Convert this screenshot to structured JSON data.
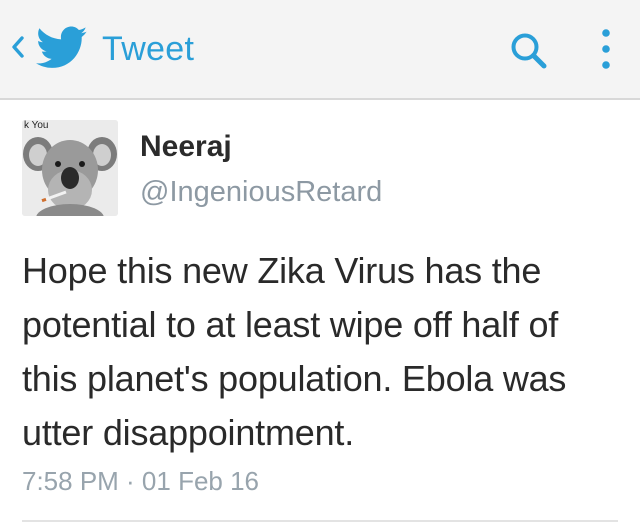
{
  "header": {
    "title": "Tweet",
    "back_icon": "chevron-left-icon",
    "logo_icon": "twitter-bird-icon",
    "search_icon": "search-icon",
    "more_icon": "more-vertical-icon",
    "accent_color": "#2a9fd8",
    "background_color": "#f4f4f4"
  },
  "tweet": {
    "avatar": {
      "caption": "k You",
      "icon": "koala-avatar"
    },
    "name": "Neeraj",
    "handle": "@IngeniousRetard",
    "text": "Hope this new Zika Virus has the potential to at least wipe off half of this planet's population. Ebola was utter disappointment.",
    "timestamp": "7:58 PM · 01 Feb 16"
  }
}
